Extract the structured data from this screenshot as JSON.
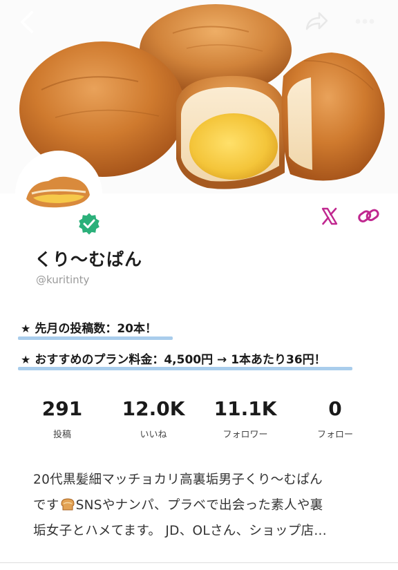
{
  "header": {
    "cover_image": "custard-cream-buns-photo",
    "back_icon": "chevron-left-icon",
    "share_icon": "share-arrow-icon",
    "more_icon": "more-dots-icon"
  },
  "profile": {
    "avatar": "cream-bun-avatar",
    "verified_icon": "verified-badge-icon",
    "name": "くり〜むぱん",
    "handle": "@kuritinty",
    "social": {
      "x_icon": "x-logo-icon",
      "link_icon": "link-icon"
    },
    "colors": {
      "accent": "#c0278f",
      "verified": "#2bb07a",
      "underline": "#a9cdec"
    }
  },
  "highlights": [
    {
      "star": "★",
      "text": "先月の投稿数：20本！"
    },
    {
      "star": "★",
      "text": "おすすめのプラン料金：4,500円 → 1本あたり36円！"
    }
  ],
  "stats": [
    {
      "value": "291",
      "label": "投稿"
    },
    {
      "value": "12.0K",
      "label": "いいね"
    },
    {
      "value": "11.1K",
      "label": "フォロワー"
    },
    {
      "value": "0",
      "label": "フォロー"
    }
  ],
  "bio": {
    "line1": "20代黒髪細マッチョカリ高裏垢男子くり〜むぱん",
    "line2_before": "です",
    "line2_after": "SNSやナンパ、プラベで出会った素人や裏",
    "line3": "垢女子とハメてます。 JD、OLさん、ショップ店...",
    "emoji": "bread-emoji"
  }
}
